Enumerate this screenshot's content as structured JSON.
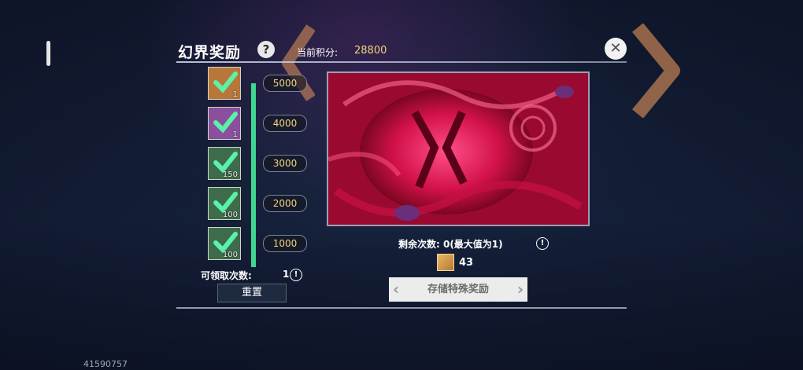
{
  "panel": {
    "title": "幻界奖励",
    "help_glyph": "?",
    "score_label": "当前积分:",
    "score_value": "28800",
    "close_glyph": "✕"
  },
  "rewards": [
    {
      "threshold": "5000",
      "count": "1",
      "claimed": true,
      "color": "#b9763a"
    },
    {
      "threshold": "4000",
      "count": "1",
      "claimed": true,
      "color": "#8b4f9e"
    },
    {
      "threshold": "3000",
      "count": "150",
      "claimed": true,
      "color": "#3f6b4d"
    },
    {
      "threshold": "2000",
      "count": "100",
      "claimed": true,
      "color": "#3f6b4d"
    },
    {
      "threshold": "1000",
      "count": "100",
      "claimed": true,
      "color": "#3f6b4d"
    }
  ],
  "progress": {
    "fraction": 1.0,
    "color": "#3fd68f"
  },
  "claim": {
    "label": "可领取次数:",
    "count": "1",
    "info_glyph": "!"
  },
  "reset_label": "重置",
  "special": {
    "remain_label": "剩余次数: 0(最大值为1)",
    "info_glyph": "!",
    "cost_value": "43",
    "store_label": "存储特殊奖励"
  },
  "uid": "41590757",
  "icons": {
    "check": "check-icon",
    "help": "help-icon",
    "close": "close-icon",
    "info": "info-icon",
    "cost": "ticket-icon"
  }
}
